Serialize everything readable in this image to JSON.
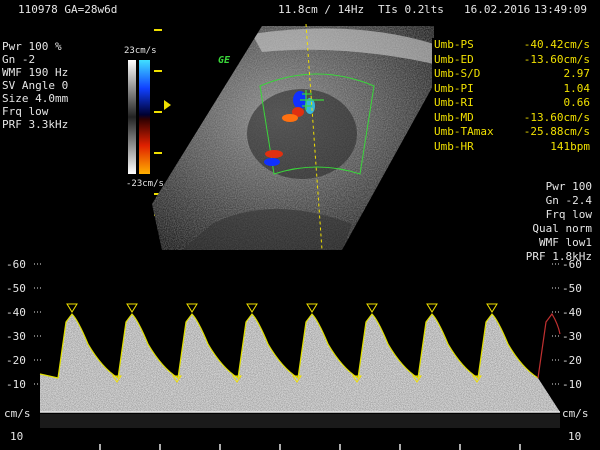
{
  "header": {
    "patient": "110978 GA=28w6d",
    "depth_freq": "11.8cm / 14Hz",
    "tis": "TIs 0.2",
    "its": "lts",
    "date": "16.02.2016",
    "time": "13:49:09"
  },
  "left_params": [
    "Pwr 100 %",
    "Gn -2",
    "WMF 190 Hz",
    "SV Angle 0",
    "Size 4.0mm",
    "Frq low",
    "PRF 3.3kHz"
  ],
  "colorbar": {
    "top_label": "23cm/s",
    "bottom_label": "-23cm/s"
  },
  "logo": "GE",
  "measurements": [
    {
      "label": "Umb-PS",
      "value": "-40.42cm/s"
    },
    {
      "label": "Umb-ED",
      "value": "-13.60cm/s"
    },
    {
      "label": "Umb-S/D",
      "value": "2.97"
    },
    {
      "label": "Umb-PI",
      "value": "1.04"
    },
    {
      "label": "Umb-RI",
      "value": "0.66"
    },
    {
      "label": "Umb-MD",
      "value": "-13.60cm/s"
    },
    {
      "label": "Umb-TAmax",
      "value": "-25.88cm/s"
    },
    {
      "label": "Umb-HR",
      "value": "141bpm"
    }
  ],
  "right_params": [
    "Pwr 100",
    "Gn -2.4",
    "Frq low",
    "Qual norm",
    "WMF low1",
    "PRF 1.8kHz"
  ],
  "spectrum_scale": {
    "ticks": [
      "-60",
      "-50",
      "-40",
      "-30",
      "-20",
      "-10"
    ],
    "unit": "cm/s",
    "below": "10"
  },
  "colors": {
    "measure_text": "#f0e000",
    "trace": "#e0e000",
    "trace_end": "#c03030",
    "logo": "#3ad63a"
  }
}
